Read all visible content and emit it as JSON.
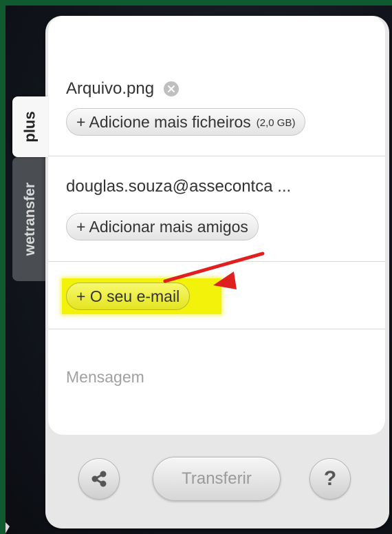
{
  "side_tabs": {
    "plus_label": "plus",
    "wetransfer_label": "wetransfer"
  },
  "files": {
    "items": [
      {
        "name": "Arquivo.png"
      }
    ],
    "add_more_label": "+ Adicione mais ficheiros",
    "add_more_size": "(2,0 GB)"
  },
  "recipients": {
    "items": [
      {
        "email": "douglas.souza@assecontca ..."
      }
    ],
    "add_more_label": "+ Adicionar mais amigos"
  },
  "sender": {
    "email_button_label": "+ O seu e-mail",
    "highlight_color": "#f2f20a",
    "arrow_color": "#e0201e"
  },
  "message": {
    "placeholder": "Mensagem"
  },
  "actions": {
    "share_icon": "share-icon",
    "transfer_label": "Transferir",
    "help_label": "?"
  },
  "colors": {
    "frame": "#0f5a2e",
    "panel": "#ffffff"
  }
}
